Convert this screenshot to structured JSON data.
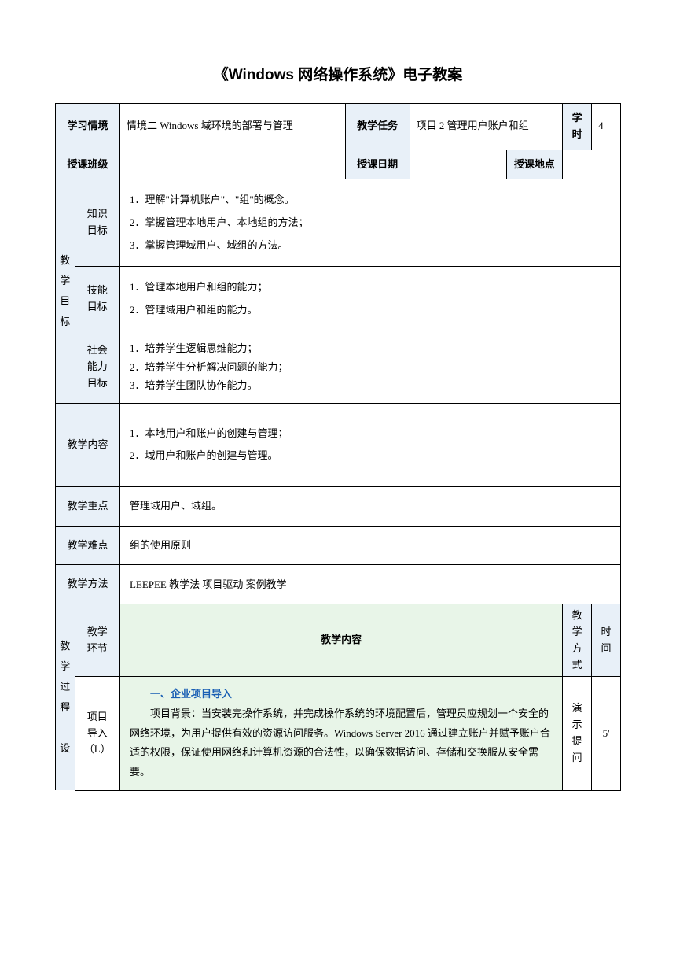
{
  "title": "《Windows 网络操作系统》电子教案",
  "row1": {
    "label1": "学习情境",
    "val1": "情境二  Windows 域环境的部署与管理",
    "label2": "教学任务",
    "val2": "项目 2  管理用户账户和组",
    "label3": "学时",
    "val3": "4"
  },
  "row2": {
    "label1": "授课班级",
    "val1": "",
    "label2": "授课日期",
    "val2": "",
    "label3": "授课地点",
    "val3": ""
  },
  "goals": {
    "vlabel": "教学目标",
    "knowledge": {
      "label": "知识目标",
      "items": [
        "1．理解\"计算机账户\"、\"组\"的概念。",
        "2．掌握管理本地用户、本地组的方法；",
        "3．掌握管理域用户、域组的方法。"
      ]
    },
    "skill": {
      "label": "技能目标",
      "items": [
        "1．管理本地用户和组的能力；",
        "2．管理域用户和组的能力。"
      ]
    },
    "social": {
      "label": "社会能力目标",
      "items": [
        "1．培养学生逻辑思维能力；",
        "2．培养学生分析解决问题的能力；",
        "3．培养学生团队协作能力。"
      ]
    }
  },
  "content": {
    "label": "教学内容",
    "items": [
      "1．本地用户和账户的创建与管理；",
      "2．域用户和账户的创建与管理。"
    ]
  },
  "focus": {
    "label": "教学重点",
    "value": "管理域用户、域组。"
  },
  "difficulty": {
    "label": "教学难点",
    "value": "组的使用原则"
  },
  "method": {
    "label": "教学方法",
    "value": "LEEPEE 教学法    项目驱动    案例教学"
  },
  "process": {
    "vlabel": "教学过程　设",
    "col_stage": "教学环节",
    "col_content": "教学内容",
    "col_mode": "教学方式",
    "col_time": "时间",
    "stage1": {
      "label": "项目导入（L）",
      "section_title": "一、企业项目导入",
      "body": "项目背景：当安装完操作系统，并完成操作系统的环境配置后，管理员应规划一个安全的网络环境，为用户提供有效的资源访问服务。Windows Server 2016 通过建立账户并赋予账户合适的权限，保证使用网络和计算机资源的合法性，以确保数据访问、存储和交换服从安全需要。",
      "mode": "演示提问",
      "time": "5'"
    }
  }
}
